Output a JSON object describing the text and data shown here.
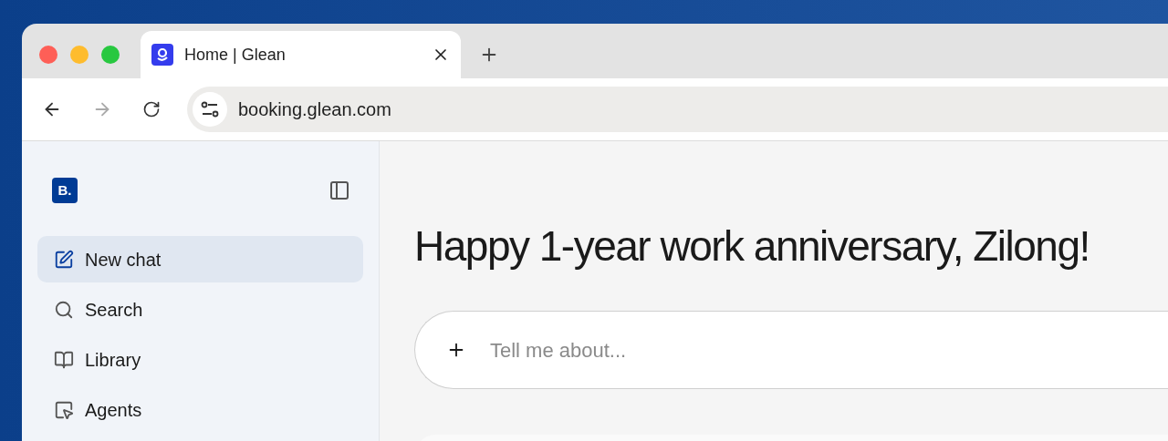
{
  "browser": {
    "tab": {
      "title": "Home | Glean",
      "selected": true
    },
    "address": "booking.glean.com",
    "forward_disabled": true
  },
  "sidebar": {
    "logo": "B.",
    "items": [
      {
        "label": "New chat",
        "selected": true
      },
      {
        "label": "Search",
        "selected": false
      },
      {
        "label": "Library",
        "selected": false
      },
      {
        "label": "Agents",
        "selected": false
      }
    ]
  },
  "main": {
    "heading": "Happy 1-year work anniversary, Zilong!",
    "chat_input": {
      "placeholder": "Tell me about..."
    }
  }
}
